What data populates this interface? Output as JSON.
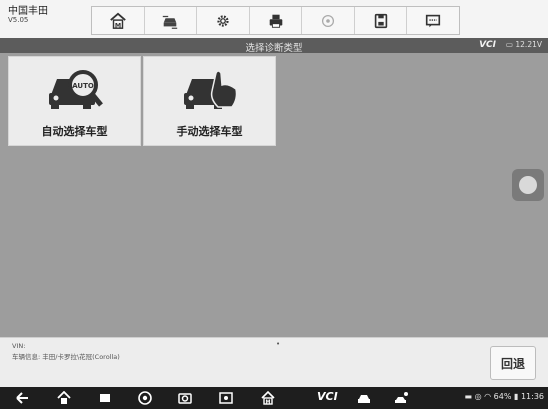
{
  "app": {
    "name": "中国丰田",
    "version": "V5.05"
  },
  "toolbar": {
    "items": [
      "home-icon",
      "vehicle-swap-icon",
      "settings-icon",
      "printer-icon",
      "help-icon",
      "save-icon",
      "chat-icon"
    ]
  },
  "header": {
    "title": "选择诊断类型",
    "vci": "VCI",
    "voltage": "12.21V"
  },
  "tiles": [
    {
      "label": "自动选择车型",
      "icon": "auto-car-icon"
    },
    {
      "label": "手动选择车型",
      "icon": "manual-car-icon"
    }
  ],
  "info": {
    "vin_label": "VIN:",
    "vehicle_info": "车辆信息: 丰田/卡罗拉\\花冠(Corolla)",
    "dot": "•"
  },
  "buttons": {
    "back": "回退"
  },
  "navbar": {
    "items": [
      "back-arrow-icon",
      "home-icon",
      "recent-apps-icon",
      "chrome-icon",
      "camera-icon",
      "screen-record-icon",
      "maxisys-icon",
      "vci-icon",
      "car-icon",
      "car-user-icon"
    ],
    "vci_label": "VCI"
  },
  "status": {
    "text": "64% ▮ 11:36",
    "battery": "64%",
    "time": "11:36"
  }
}
